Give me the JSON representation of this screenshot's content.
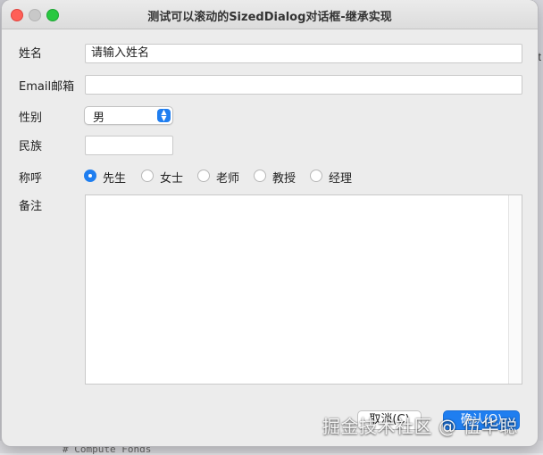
{
  "window": {
    "title": "测试可以滚动的SizedDialog对话框-继承实现"
  },
  "form": {
    "name": {
      "label": "姓名",
      "value": "请输入姓名"
    },
    "email": {
      "label": "Email邮箱",
      "value": ""
    },
    "gender": {
      "label": "性别",
      "selected": "男"
    },
    "ethnicity": {
      "label": "民族",
      "value": ""
    },
    "title": {
      "label": "称呼",
      "options": [
        "先生",
        "女士",
        "老师",
        "教授",
        "经理"
      ],
      "selected": "先生"
    },
    "notes": {
      "label": "备注",
      "value": ""
    }
  },
  "buttons": {
    "cancel": "取消(C)",
    "ok": "确认(O)"
  },
  "watermark": "掘金技术社区 @ 伍华聪",
  "background": {
    "right_char": "t",
    "code_snippet": "# Compute Fonds"
  },
  "colors": {
    "accent": "#1f7ef0",
    "close": "#ff5f57",
    "maximize": "#28c840"
  }
}
